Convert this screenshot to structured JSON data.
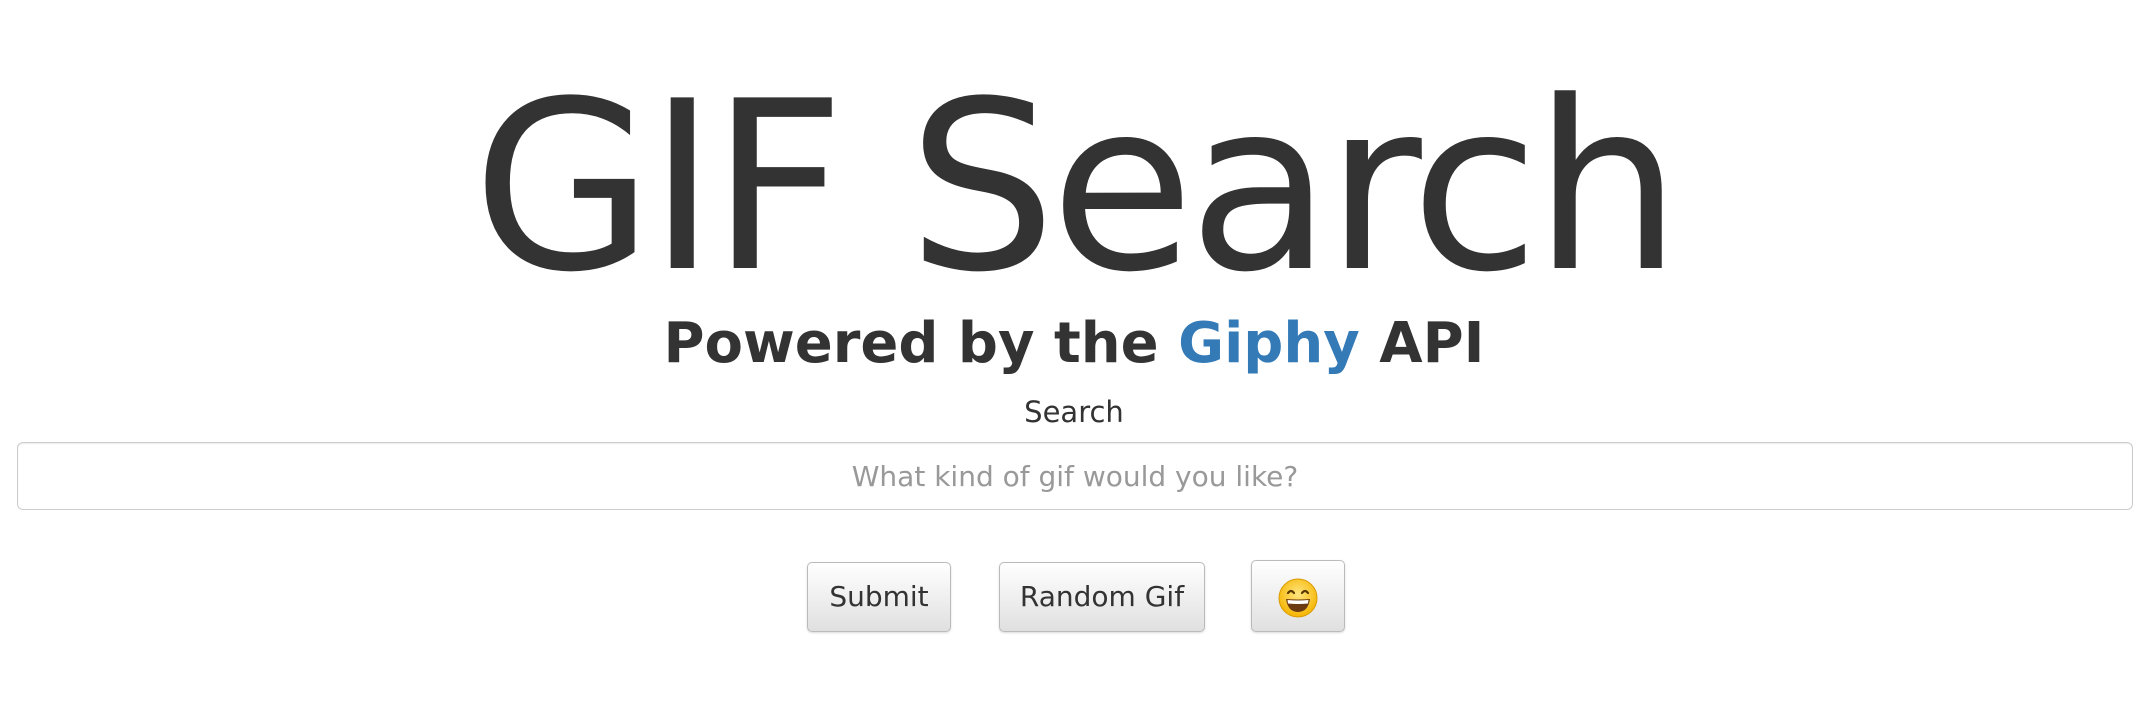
{
  "header": {
    "title": "GIF Search",
    "subtitle_prefix": "Powered by the",
    "subtitle_link": "Giphy",
    "subtitle_suffix": "API"
  },
  "search": {
    "label": "Search",
    "placeholder": "What kind of gif would you like?",
    "value": ""
  },
  "buttons": {
    "submit_label": "Submit",
    "random_label": "Random Gif",
    "emoji_icon": "grinning-face-emoji-icon"
  },
  "colors": {
    "text": "#333333",
    "link": "#337ab7",
    "placeholder": "#999999",
    "border": "#cccccc",
    "emoji_face": "#f7c02b"
  }
}
